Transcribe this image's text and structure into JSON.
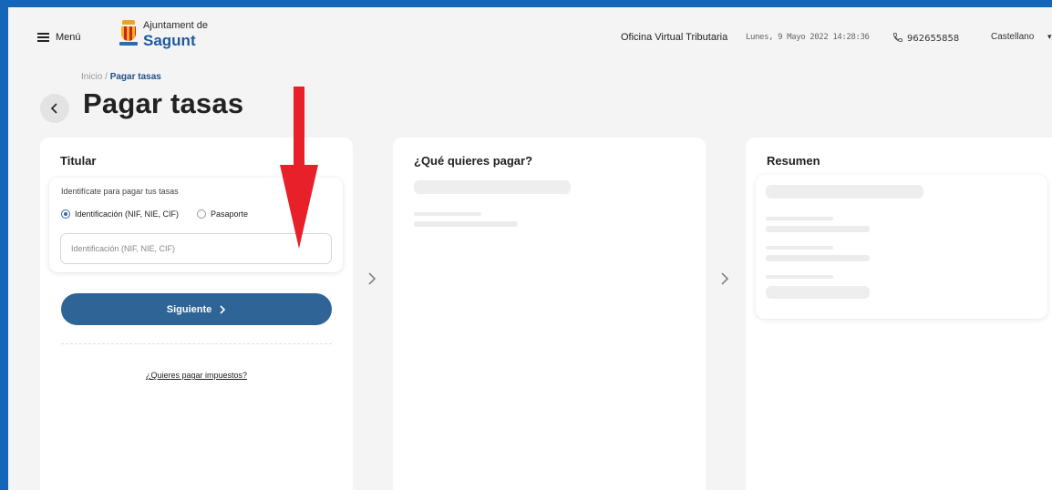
{
  "header": {
    "menu_label": "Menú",
    "logo_top": "Ajuntament de",
    "logo_bottom": "Sagunt",
    "office": "Oficina Virtual Tributaria",
    "datetime": "Lunes, 9 Mayo 2022 14:28:36",
    "phone": "962655858",
    "language": "Castellano"
  },
  "breadcrumb": {
    "home": "Inicio",
    "sep": "/",
    "current": "Pagar tasas"
  },
  "page": {
    "title": "Pagar tasas"
  },
  "titular": {
    "title": "Titular",
    "card_label": "Identifícate para pagar tus tasas",
    "radio_id": "Identificación (NIF, NIE, CIF)",
    "radio_passport": "Pasaporte",
    "selected": "Identificación (NIF, NIE, CIF)",
    "input_placeholder": "Identificación (NIF, NIE, CIF)",
    "input_value": "",
    "next_label": "Siguiente",
    "link_label": "¿Quieres pagar impuestos?"
  },
  "que_pagar": {
    "title": "¿Qué quieres pagar?"
  },
  "resumen": {
    "title": "Resumen"
  },
  "icons": [
    "hamburger-icon",
    "phone-icon",
    "chevron-left-icon",
    "chevron-right-icon",
    "chevron-down-icon",
    "annotation-arrow"
  ],
  "colors": {
    "frame": "#1565b8",
    "primary": "#2f6496",
    "title_blue": "#1f5a9e",
    "annotation": "#e8202a"
  }
}
